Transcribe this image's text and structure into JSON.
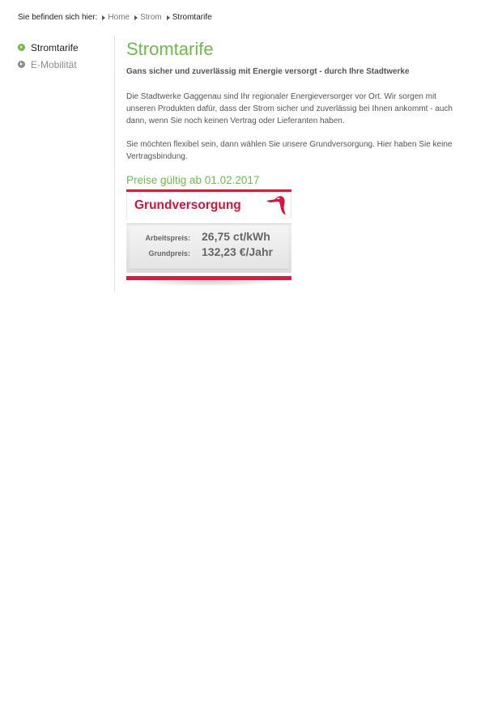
{
  "breadcrumb": {
    "lead": "Sie befinden sich hier:",
    "items": [
      "Home",
      "Strom",
      "Stromtarife"
    ]
  },
  "sidebar": {
    "items": [
      {
        "label": "Stromtarife",
        "active": true
      },
      {
        "label": "E-Mobilität",
        "active": false
      }
    ]
  },
  "main": {
    "title": "Stromtarife",
    "subtitle": "Gans sicher und zuverlässig mit Energie versorgt - durch Ihre Stadtwerke",
    "paragraph1": "Die Stadtwerke Gaggenau sind Ihr regionaler Energieversorger vor Ort. Wir sorgen mit unseren Produkten dafür, dass der Strom sicher und zuverlässig bei Ihnen ankommt - auch dann, wenn Sie noch keinen Vertrag oder Lieferanten haben.",
    "paragraph2": "Sie möchten flexibel sein, dann wählen Sie unsere Grundversorgung. Hier haben Sie keine Vertragsbindung.",
    "prices_title": "Preise gültig ab 01.02.2017"
  },
  "tariff_card": {
    "title": "Grundversorgung",
    "rows": [
      {
        "label": "Arbeitspreis:",
        "value": "26,75 ct/kWh"
      },
      {
        "label": "Grundpreis:",
        "value": "132,23  €/Jahr"
      }
    ]
  },
  "colors": {
    "accent_green": "#6cbd45",
    "brand_red": "#e2183a",
    "text_gray": "#555555"
  },
  "icons": {
    "breadcrumb_separator": "triangle-right-icon",
    "sidebar_bullet": "circle-arrow-right-icon",
    "card_logo": "goose-logo-icon"
  }
}
